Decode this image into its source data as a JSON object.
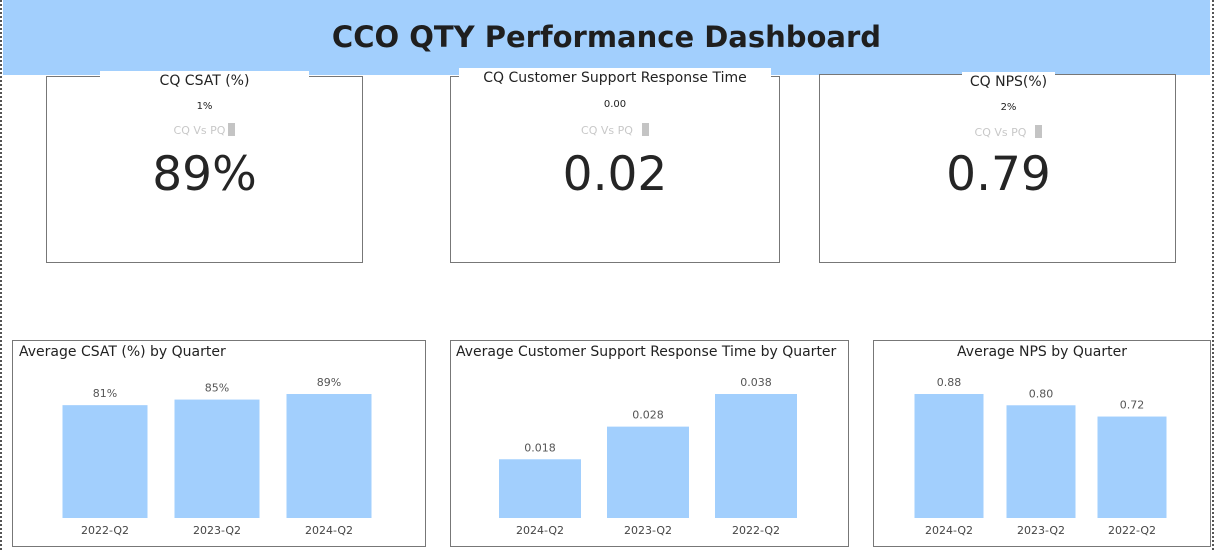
{
  "header": {
    "title": "CCO QTY Performance Dashboard"
  },
  "kpis": [
    {
      "title": "CQ CSAT (%)",
      "delta": "1%",
      "compare_label": "CQ Vs PQ",
      "value": "89%"
    },
    {
      "title": "CQ Customer Support Response Time",
      "delta": "0.00",
      "compare_label": "CQ Vs PQ",
      "value": "0.02"
    },
    {
      "title": "CQ NPS(%)",
      "delta": "2%",
      "compare_label": "CQ Vs PQ",
      "value": "0.79"
    }
  ],
  "colors": {
    "header_bg": "#a2cffd",
    "bar_fill": "#a2cffd",
    "compare_indicator": "#c4c4c4"
  },
  "chart_data": [
    {
      "type": "bar",
      "title": "Average CSAT (%) by Quarter",
      "categories": [
        "2022-Q2",
        "2023-Q2",
        "2024-Q2"
      ],
      "values": [
        81,
        85,
        89
      ],
      "data_labels": [
        "81%",
        "85%",
        "89%"
      ],
      "ylim": [
        0,
        89
      ],
      "xlabel": "",
      "ylabel": "",
      "grid": false
    },
    {
      "type": "bar",
      "title": "Average Customer Support Response Time by Quarter",
      "categories": [
        "2024-Q2",
        "2023-Q2",
        "2022-Q2"
      ],
      "values": [
        0.018,
        0.028,
        0.038
      ],
      "data_labels": [
        "0.018",
        "0.028",
        "0.038"
      ],
      "ylim": [
        0,
        0.038
      ],
      "xlabel": "",
      "ylabel": "",
      "grid": false
    },
    {
      "type": "bar",
      "title": "Average NPS by Quarter",
      "categories": [
        "2024-Q2",
        "2023-Q2",
        "2022-Q2"
      ],
      "values": [
        0.88,
        0.8,
        0.72
      ],
      "data_labels": [
        "0.88",
        "0.80",
        "0.72"
      ],
      "ylim": [
        0,
        0.88
      ],
      "xlabel": "",
      "ylabel": "",
      "grid": false
    }
  ]
}
